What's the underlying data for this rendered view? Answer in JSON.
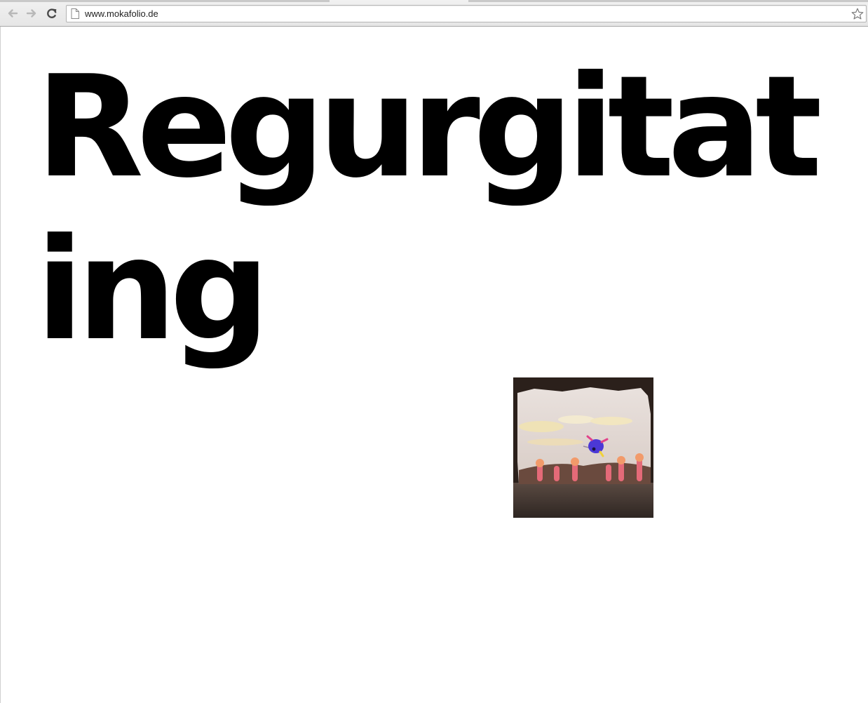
{
  "browser": {
    "url": "www.mokafolio.de",
    "icons": {
      "back": "arrow-left-icon",
      "forward": "arrow-right-icon",
      "reload": "reload-icon",
      "page": "page-icon",
      "bookmark": "star-icon"
    }
  },
  "page": {
    "heading": "Regurgitating",
    "thumbnail": {
      "kind": "illustration of a puppet-theatre stage with a small purple figure above a row of pink creatures"
    }
  },
  "colors": {
    "text": "#000000",
    "background": "#ffffff",
    "chrome": "#e9e9e9"
  }
}
